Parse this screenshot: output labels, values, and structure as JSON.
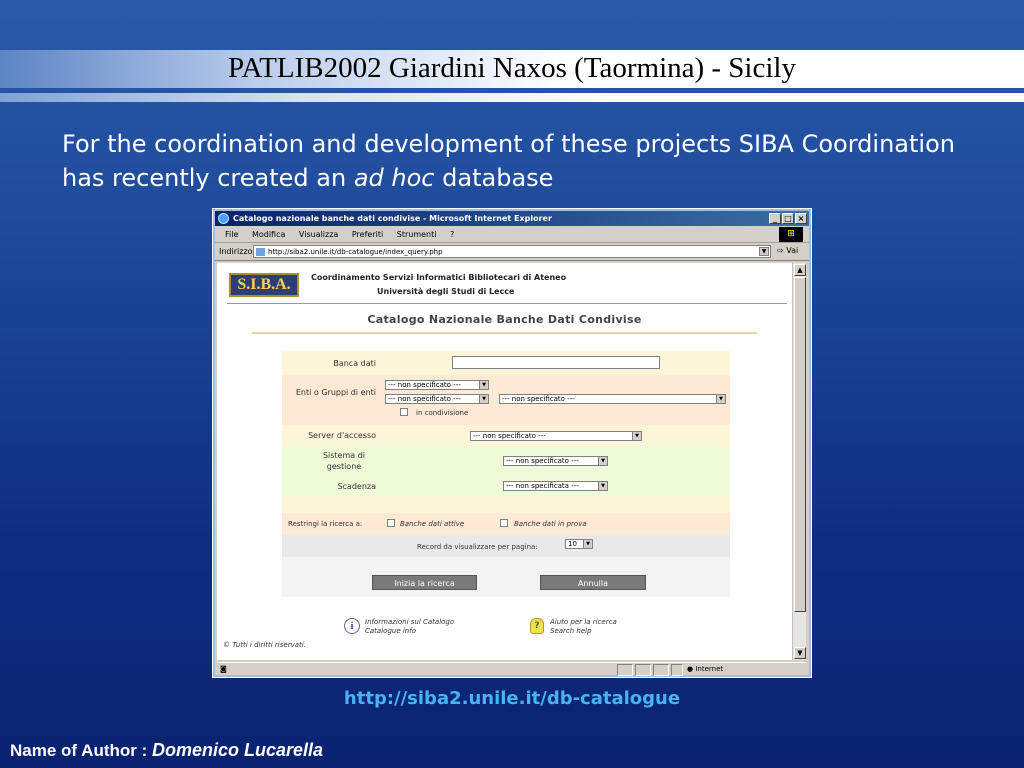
{
  "slide": {
    "title": "PATLIB2002 Giardini Naxos (Taormina) - Sicily",
    "intro_before": "For the coordination and development of these projects SIBA Coordination has recently created an ",
    "intro_italic": "ad hoc",
    "intro_after": " database",
    "url": "http://siba2.unile.it/db-catalogue",
    "author_label": "Name of Author : ",
    "author_name": "Domenico Lucarella"
  },
  "browser": {
    "window_title": "Catalogo nazionale banche dati condivise - Microsoft Internet Explorer",
    "controls": [
      "_",
      "□",
      "×"
    ],
    "menu": [
      "File",
      "Modifica",
      "Visualizza",
      "Preferiti",
      "Strumenti",
      "?"
    ],
    "address_label": "Indirizzo",
    "address_value": "http://siba2.unile.it/db-catalogue/index_query.php",
    "go_label": "Vai",
    "status_zone": "Internet"
  },
  "page": {
    "logo_text": "S.I.B.A.",
    "header_line1": "Coordinamento Servizi Informatici Bibliotecari di Ateneo",
    "header_line2": "Università degli Studi di Lecce",
    "catalog_title": "Catalogo Nazionale Banche Dati Condivise",
    "form": {
      "banca_dati_label": "Banca dati",
      "enti_label": "Enti o Gruppi di enti",
      "enti_select1": "--- non specificato ---",
      "enti_select2": "--- non specificato ---",
      "enti_select3": "--- non specificato ---",
      "in_condivisione_label": "in condivisione",
      "server_label": "Server d'accesso",
      "server_select": "--- non specificato ---",
      "sistema_label": "Sistema di gestione",
      "sistema_select": "--- non specificato ---",
      "scadenza_label": "Scadenza",
      "scadenza_select": "--- non specificata ---",
      "restringi_label": "Restringi la ricerca a:",
      "attive_label": "Banche dati attive",
      "prova_label": "Banche dati in prova",
      "record_label": "Record da visualizzare per pagina:",
      "record_value": "10",
      "search_button": "Inizia la ricerca",
      "cancel_button": "Annulla"
    },
    "info_line1": "Informazioni sul Catalogo",
    "info_line2": "Catalogue info",
    "help_line1": "Aiuto per la ricerca",
    "help_line2": "Search help",
    "copyright": "© Tutti i diritti riservati."
  },
  "colors": {
    "row_yellow": "#fdf5d8",
    "row_peach": "#fde9d4",
    "row_green": "#eefad8",
    "row_gray": "#e9e9e9",
    "url_color": "#46b4f0"
  }
}
